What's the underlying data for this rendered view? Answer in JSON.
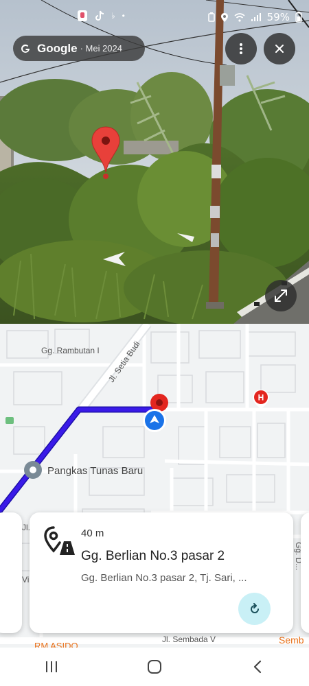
{
  "status_bar": {
    "battery": "59%"
  },
  "imagery_chip": {
    "brand": "Google",
    "date": "· Mei 2024"
  },
  "street_view": {
    "more_button_icon": "more-vert-icon",
    "close_button_icon": "close-icon",
    "expand_button_icon": "fullscreen-icon"
  },
  "map": {
    "street_labels": {
      "gg_rambutan": "Gg. Rambutan I",
      "jl_setia_budi": "Jl. Setia Budi",
      "jl_sembada": "Jl. Sembada V",
      "sembada_right": "Semb",
      "rm_asido": "RM ASIDO",
      "gg_dan": "Gg. D...",
      "jl_left": "Jl.",
      "vi_left": "Vi"
    },
    "poi": {
      "pangkas": "Pangkas Tunas Baru"
    },
    "route_color": "#3a1ae8",
    "pin_color": "#e3261f",
    "location_color": "#1a73e8",
    "hospital_color": "#e3261f"
  },
  "card": {
    "distance": "40 m",
    "title": "Gg. Berlian No.3 pasar 2",
    "subtitle": "Gg. Berlian No.3 pasar 2, Tj. Sari, ...",
    "icon": "place-road-icon",
    "refresh_icon": "refresh-icon",
    "refresh_color": "#c9f0f6"
  },
  "nav_bar": {
    "recents_icon": "recents-icon",
    "home_icon": "home-icon",
    "back_icon": "back-icon"
  }
}
